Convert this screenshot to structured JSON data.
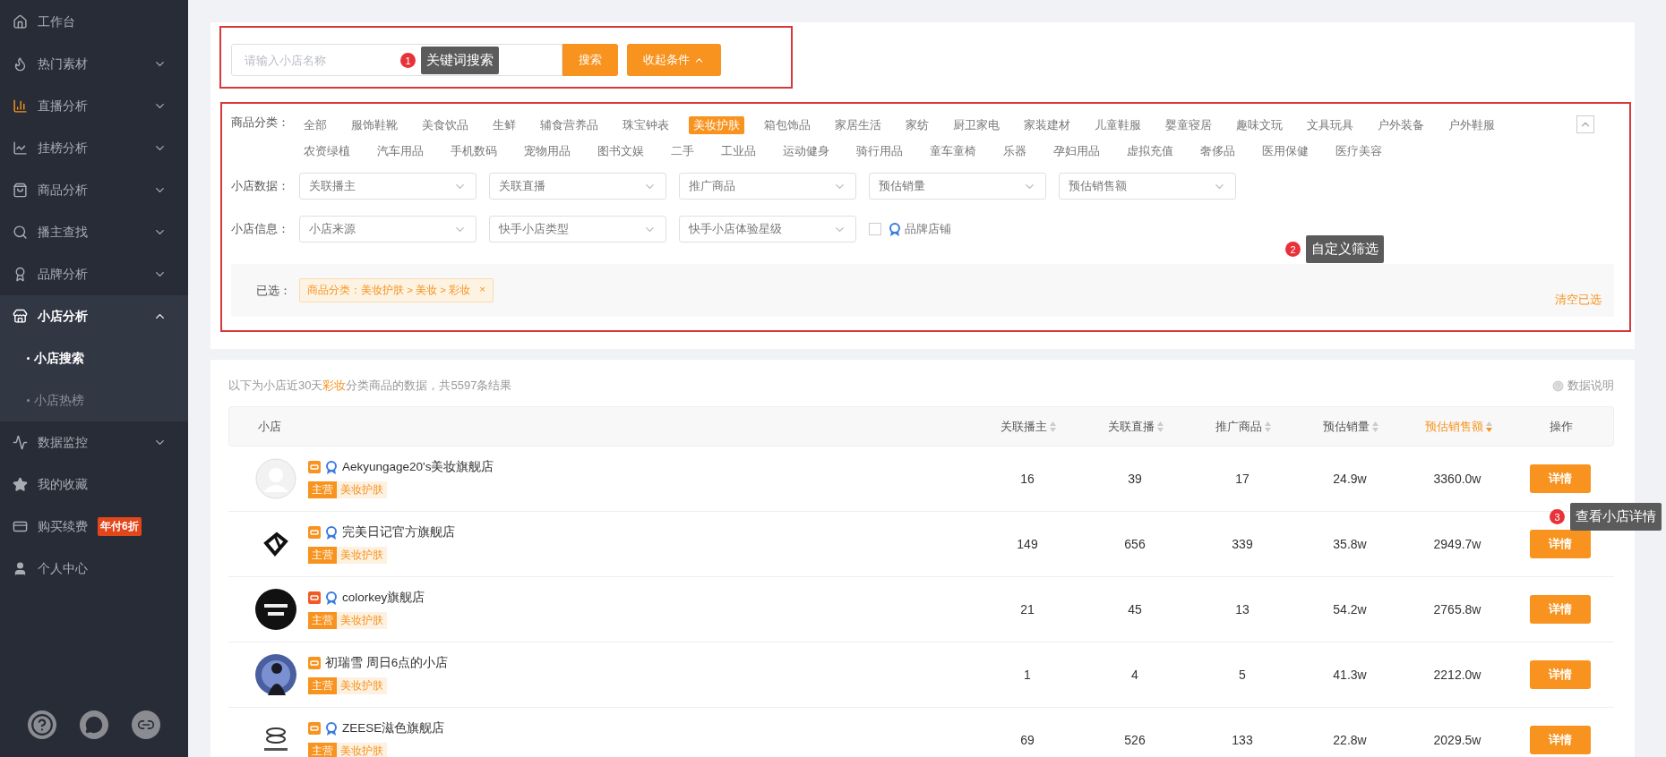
{
  "sidebar": {
    "items": [
      {
        "label": "工作台"
      },
      {
        "label": "热门素材",
        "expanded": false
      },
      {
        "label": "直播分析",
        "expanded": false
      },
      {
        "label": "挂榜分析",
        "expanded": false
      },
      {
        "label": "商品分析",
        "expanded": false
      },
      {
        "label": "播主查找",
        "expanded": false
      },
      {
        "label": "品牌分析",
        "expanded": false
      },
      {
        "label": "小店分析",
        "expanded": true,
        "children": [
          {
            "label": "小店搜索",
            "selected": true
          },
          {
            "label": "小店热榜",
            "selected": false
          }
        ]
      },
      {
        "label": "数据监控",
        "expanded": false
      },
      {
        "label": "我的收藏"
      },
      {
        "label": "购买续费",
        "badge": "年付6折"
      },
      {
        "label": "个人中心"
      }
    ]
  },
  "search": {
    "placeholder": "请输入小店名称",
    "button": "搜索",
    "collapse_button": "收起条件"
  },
  "filters": {
    "category_label": "商品分类：",
    "category_rows": [
      {
        "items": [
          {
            "label": "全部",
            "selected": false
          },
          {
            "label": "服饰鞋靴",
            "selected": false
          },
          {
            "label": "美食饮品",
            "selected": false
          },
          {
            "label": "生鲜",
            "selected": false
          },
          {
            "label": "辅食营养品",
            "selected": false
          },
          {
            "label": "珠宝钟表",
            "selected": false
          },
          {
            "label": "美妆护肤",
            "selected": true
          },
          {
            "label": "箱包饰品",
            "selected": false
          },
          {
            "label": "家居生活",
            "selected": false
          },
          {
            "label": "家纺",
            "selected": false
          },
          {
            "label": "厨卫家电",
            "selected": false
          },
          {
            "label": "家装建材",
            "selected": false
          },
          {
            "label": "儿童鞋服",
            "selected": false
          },
          {
            "label": "婴童寝居",
            "selected": false
          },
          {
            "label": "趣味文玩",
            "selected": false
          },
          {
            "label": "文具玩具",
            "selected": false
          },
          {
            "label": "户外装备",
            "selected": false
          },
          {
            "label": "户外鞋服",
            "selected": false
          }
        ]
      },
      {
        "items": [
          {
            "label": "农资绿植",
            "selected": false
          },
          {
            "label": "汽车用品",
            "selected": false
          },
          {
            "label": "手机数码",
            "selected": false
          },
          {
            "label": "宠物用品",
            "selected": false
          },
          {
            "label": "图书文娱",
            "selected": false
          },
          {
            "label": "二手",
            "selected": false
          },
          {
            "label": "工业品",
            "selected": false
          },
          {
            "label": "运动健身",
            "selected": false
          },
          {
            "label": "骑行用品",
            "selected": false
          },
          {
            "label": "童车童椅",
            "selected": false
          },
          {
            "label": "乐器",
            "selected": false
          },
          {
            "label": "孕妇用品",
            "selected": false
          },
          {
            "label": "虚拟充值",
            "selected": false
          },
          {
            "label": "奢侈品",
            "selected": false
          },
          {
            "label": "医用保健",
            "selected": false
          },
          {
            "label": "医疗美容",
            "selected": false
          }
        ]
      }
    ],
    "dropdown_rows": [
      {
        "label": "小店数据：",
        "dropdowns": [
          "关联播主",
          "关联直播",
          "推广商品",
          "预估销量",
          "预估销售额"
        ]
      },
      {
        "label": "小店信息：",
        "dropdowns": [
          "小店来源",
          "快手小店类型",
          "快手小店体验星级"
        ],
        "checkbox": {
          "label": "品牌店铺",
          "checked": false
        }
      }
    ],
    "selected_label": "已选：",
    "chips": [
      "商品分类：美妆护肤 > 美妆 > 彩妆"
    ],
    "chip_close": "×",
    "clear_link": "清空已选"
  },
  "results": {
    "summary_before": "以下为小店近30天",
    "summary_highlight": "彩妆",
    "summary_after": "分类商品的数据，共5597条结果",
    "help_link": "数据说明",
    "shop_column": "小店",
    "columns": [
      {
        "label": "关联播主",
        "sorted": false
      },
      {
        "label": "关联直播",
        "sorted": false
      },
      {
        "label": "推广商品",
        "sorted": false
      },
      {
        "label": "预估销量",
        "sorted": false
      },
      {
        "label": "预估销售额",
        "sorted": true
      }
    ],
    "action_column": "操作",
    "rows": [
      {
        "avatar": {
          "kind": "placeholder"
        },
        "platform": {
          "color": "#f7931e"
        },
        "brand": true,
        "name": "Aekyungage20's美妆旗舰店",
        "tag_main": "主营",
        "tag": "美妆护肤",
        "cells": [
          "16",
          "39",
          "17",
          "24.9w",
          "3360.0w"
        ],
        "action": "详情"
      },
      {
        "avatar": {
          "kind": "diamond"
        },
        "platform": {
          "color": "#f7931e"
        },
        "brand": true,
        "name": "完美日记官方旗舰店",
        "tag_main": "主营",
        "tag": "美妆护肤",
        "cells": [
          "149",
          "656",
          "339",
          "35.8w",
          "2949.7w"
        ],
        "action": "详情"
      },
      {
        "avatar": {
          "kind": "dark"
        },
        "platform": {
          "color": "#f05a24"
        },
        "brand": true,
        "name": "colorkey旗舰店",
        "tag_main": "主营",
        "tag": "美妆护肤",
        "cells": [
          "21",
          "45",
          "13",
          "54.2w",
          "2765.8w"
        ],
        "action": "详情"
      },
      {
        "platform": {
          "color": "#f7931e"
        },
        "brand": false,
        "name": "初瑞雪 周日6点的小店",
        "tag_main": "主营",
        "tag": "美妆护肤",
        "cells": [
          "1",
          "4",
          "5",
          "41.3w",
          "2212.0w"
        ],
        "action": "详情"
      },
      {
        "avatar": {
          "kind": "ring"
        },
        "platform": {
          "color": "#f7931e"
        },
        "brand": true,
        "name": "ZEESE滋色旗舰店",
        "tag_main": "主营",
        "tag": "美妆护肤",
        "cells": [
          "69",
          "526",
          "133",
          "22.8w",
          "2029.5w"
        ],
        "action": "详情"
      }
    ]
  },
  "annotations": [
    {
      "number": "1",
      "text": "关键词搜索"
    },
    {
      "number": "2",
      "text": "自定义筛选"
    },
    {
      "number": "3",
      "text": "查看小店详情"
    }
  ]
}
